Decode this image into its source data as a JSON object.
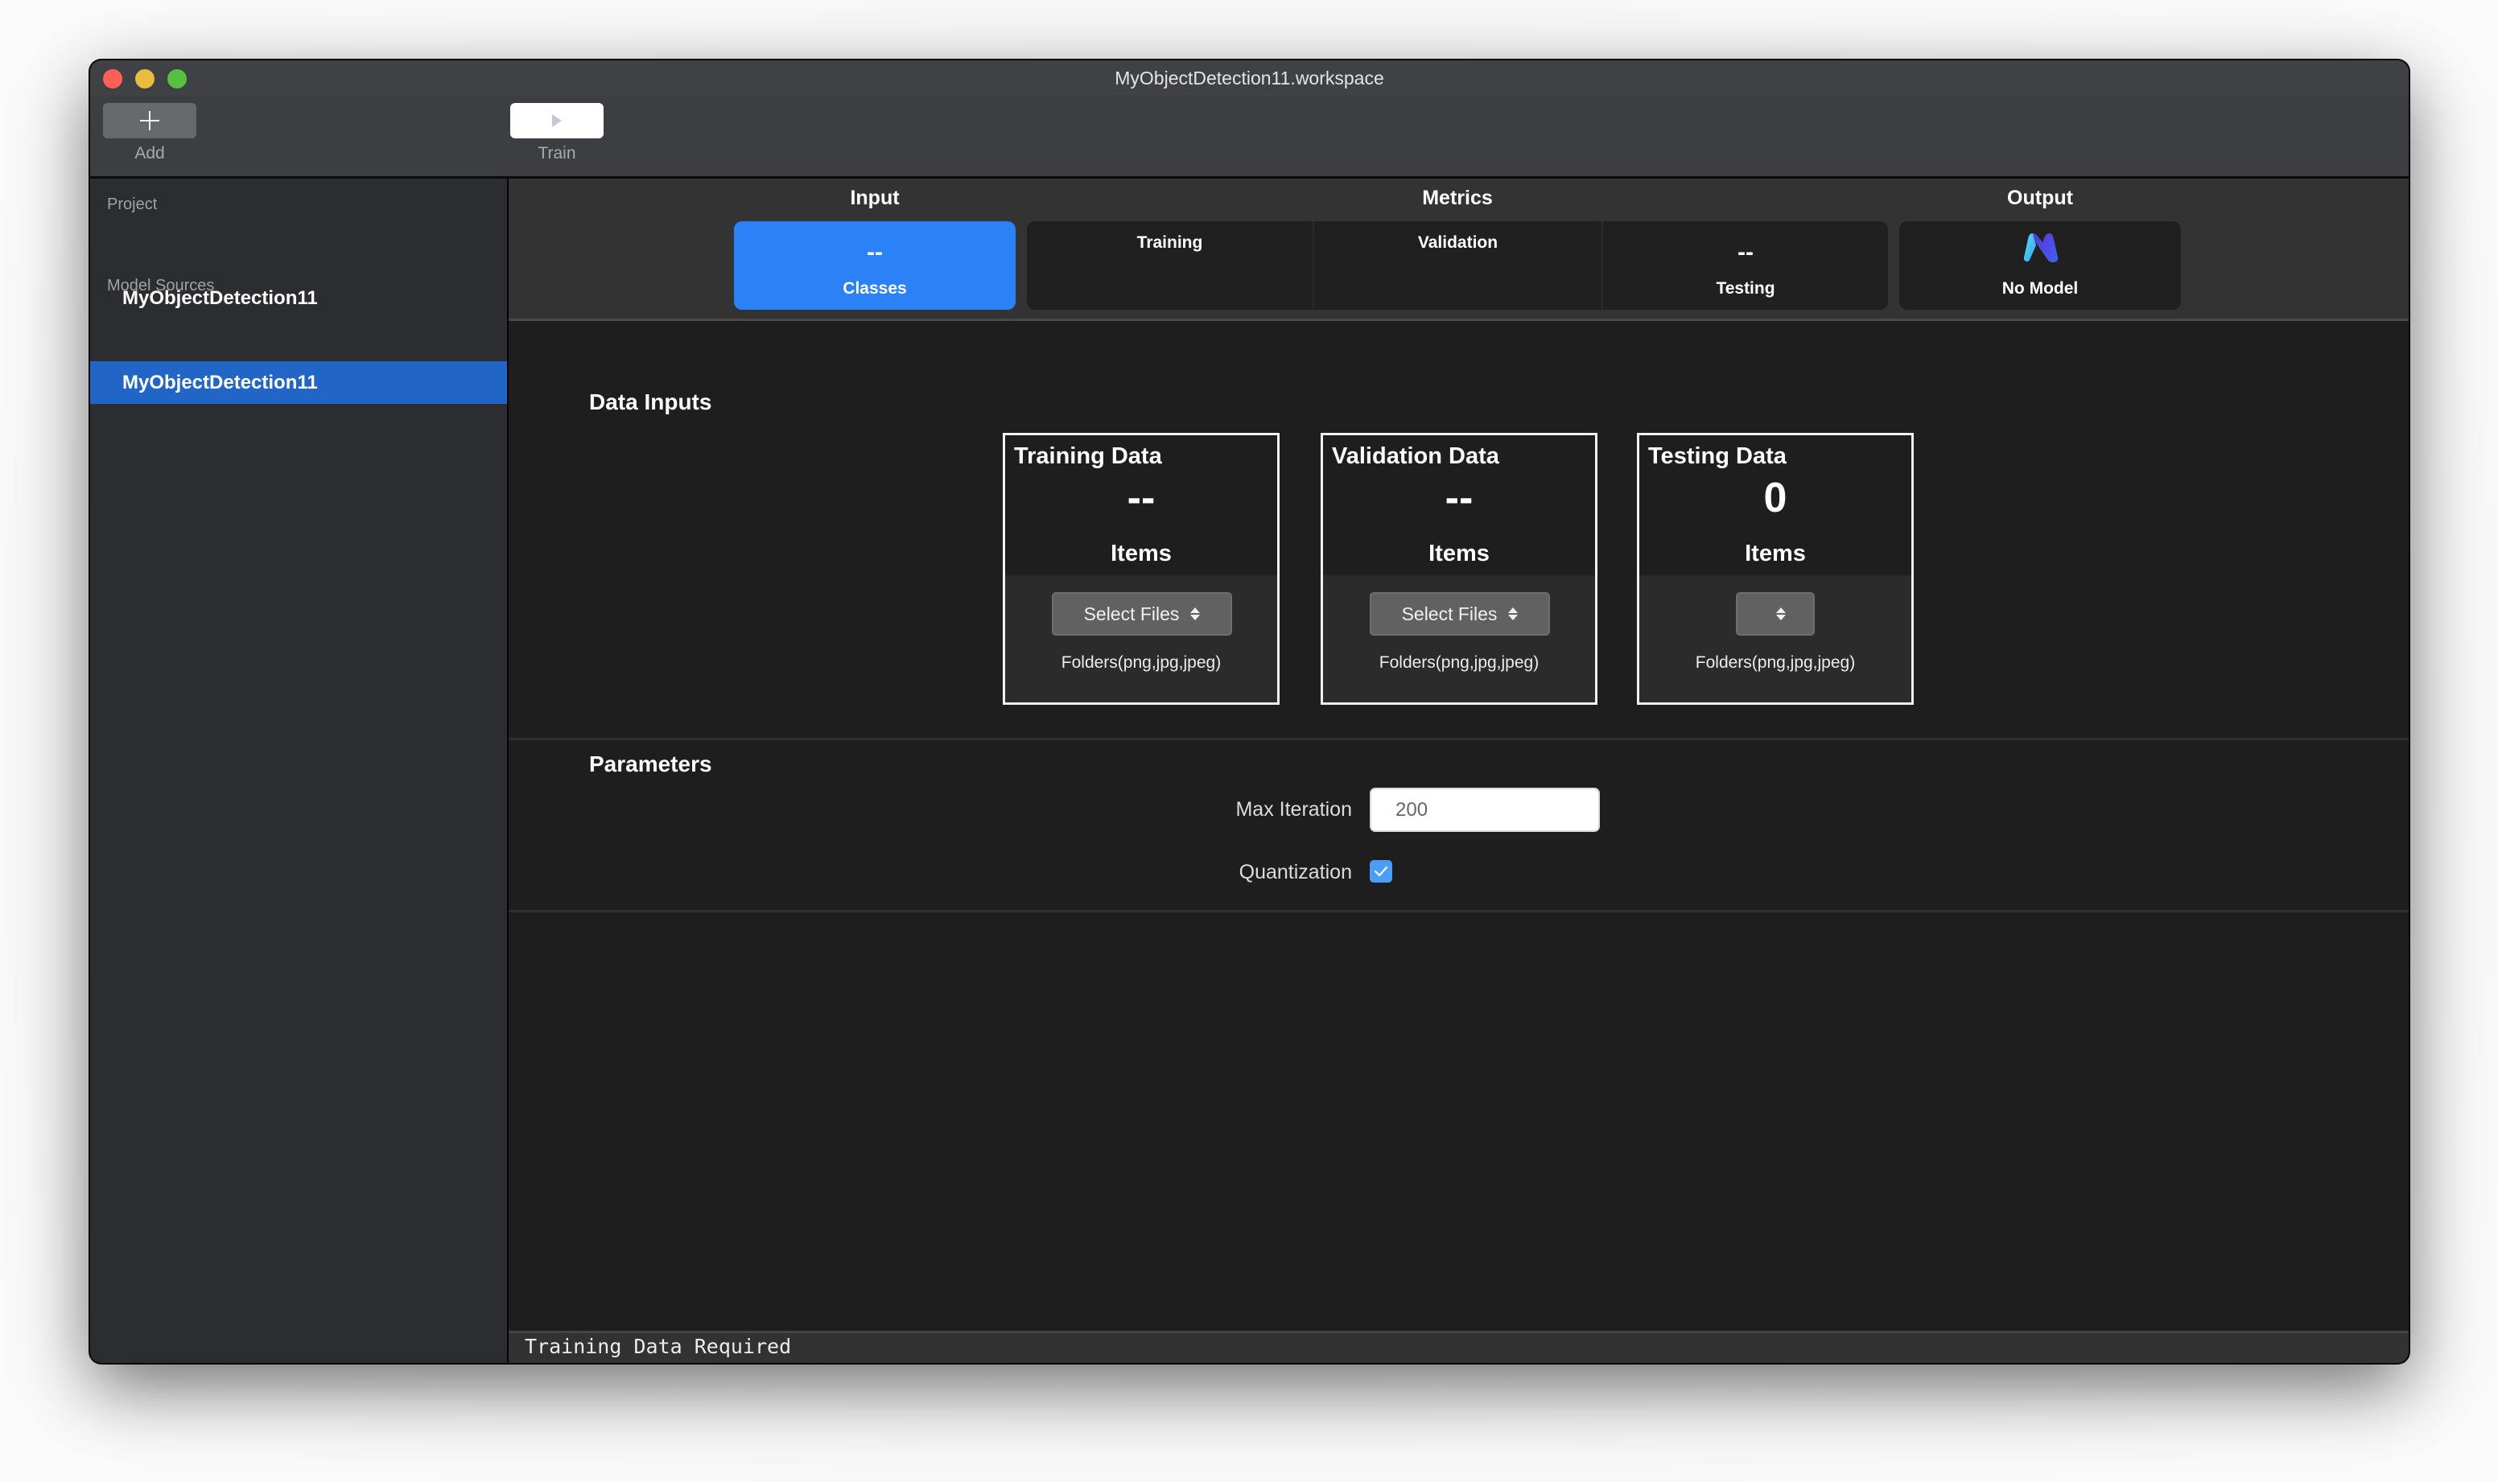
{
  "window": {
    "title": "MyObjectDetection11.workspace"
  },
  "toolbar": {
    "add_label": "Add",
    "train_label": "Train"
  },
  "sidebar": {
    "sections": [
      {
        "label": "Project",
        "items": [
          {
            "label": "MyObjectDetection11",
            "selected": false
          }
        ]
      },
      {
        "label": "Model Sources",
        "items": [
          {
            "label": "MyObjectDetection11",
            "selected": true
          }
        ]
      }
    ]
  },
  "tabs": {
    "input": {
      "group_label": "Input",
      "value": "--",
      "caption": "Classes",
      "active": true
    },
    "metrics": {
      "group_label": "Metrics",
      "training": {
        "title": "Training"
      },
      "validation": {
        "title": "Validation"
      },
      "testing": {
        "value": "--",
        "caption": "Testing"
      }
    },
    "output": {
      "group_label": "Output",
      "icon": "create-ml-model-icon",
      "caption": "No Model"
    }
  },
  "data_inputs": {
    "title": "Data Inputs",
    "cards": [
      {
        "title": "Training Data",
        "count": "--",
        "unit": "Items",
        "button_label": "Select Files",
        "formats": "Folders(png,jpg,jpeg)"
      },
      {
        "title": "Validation Data",
        "count": "--",
        "unit": "Items",
        "button_label": "Select Files",
        "formats": "Folders(png,jpg,jpeg)"
      },
      {
        "title": "Testing Data",
        "count": "0",
        "unit": "Items",
        "button_label": "",
        "formats": "Folders(png,jpg,jpeg)"
      }
    ]
  },
  "parameters": {
    "title": "Parameters",
    "max_iteration": {
      "label": "Max Iteration",
      "value": "200"
    },
    "quantization": {
      "label": "Quantization",
      "checked": true
    }
  },
  "status": {
    "message": "Training Data Required"
  },
  "colors": {
    "accent": "#2b82f7",
    "sidebar_selected": "#2166c7",
    "checkbox": "#4a9df8"
  }
}
